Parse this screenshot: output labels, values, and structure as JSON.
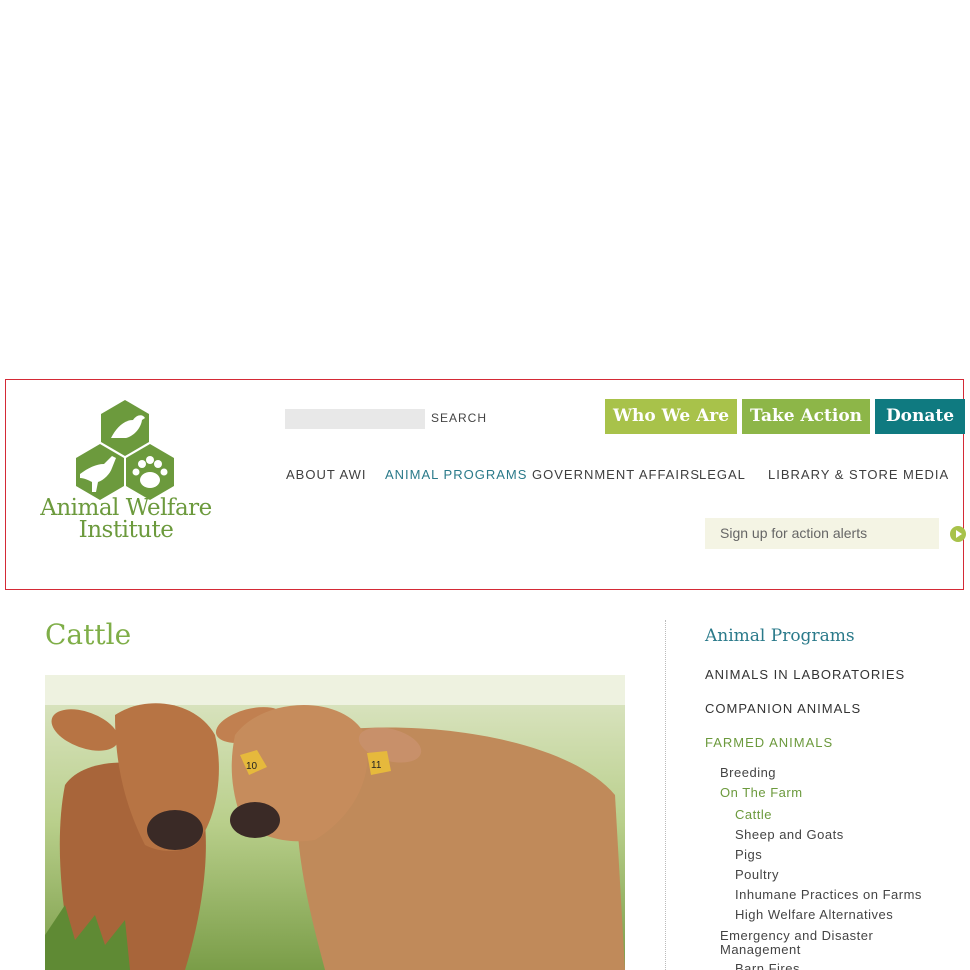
{
  "header": {
    "logo_text_line1": "Animal Welfare",
    "logo_text_line2": "Institute",
    "search_label": "SEARCH",
    "search_placeholder": "",
    "buttons": {
      "who_we_are": "Who We Are",
      "take_action": "Take Action",
      "donate": "Donate"
    },
    "nav": [
      "ABOUT AWI",
      "ANIMAL PROGRAMS",
      "GOVERNMENT AFFAIRS",
      "LEGAL",
      "LIBRARY & STORE",
      "MEDIA"
    ],
    "alerts_placeholder": "Sign up for action alerts"
  },
  "colors": {
    "brand_green": "#6c9a3d",
    "button_lime": "#a8c24a",
    "button_green": "#8db648",
    "button_teal": "#0f7a80",
    "link_teal": "#2a7a8a",
    "highlight_border": "#d42a36"
  },
  "main": {
    "title": "Cattle",
    "hero_image": "calves-photo"
  },
  "sidebar": {
    "title": "Animal Programs",
    "categories": [
      "ANIMALS IN LABORATORIES",
      "COMPANION ANIMALS",
      "FARMED ANIMALS"
    ],
    "farmed_sub": [
      "Breeding",
      "On The Farm"
    ],
    "on_the_farm_sub": [
      "Cattle",
      "Sheep and Goats",
      "Pigs",
      "Poultry",
      "Inhumane Practices on Farms",
      "High Welfare Alternatives"
    ],
    "emergency": "Emergency and Disaster Management",
    "cut_off_item": "Barn Fires"
  }
}
